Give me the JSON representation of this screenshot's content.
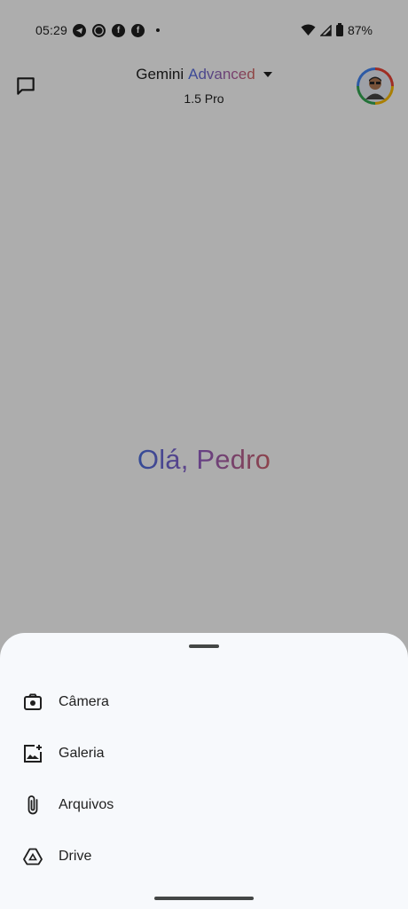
{
  "status_bar": {
    "time": "05:29",
    "notification_icons": [
      "telegram-icon",
      "whatsapp-icon",
      "facebook-icon",
      "facebook-icon"
    ],
    "battery": "87%"
  },
  "header": {
    "title_prefix": "Gemini",
    "title_tier": "Advanced",
    "model": "1.5 Pro"
  },
  "main": {
    "greeting": "Olá, Pedro"
  },
  "sheet": {
    "items": [
      {
        "label": "Câmera",
        "icon": "camera-icon"
      },
      {
        "label": "Galeria",
        "icon": "gallery-icon"
      },
      {
        "label": "Arquivos",
        "icon": "paperclip-icon"
      },
      {
        "label": "Drive",
        "icon": "drive-icon"
      }
    ]
  },
  "colors": {
    "sheet_bg": "#f7f9fc",
    "scrim": "rgba(0,0,0,0.32)",
    "gradient_start": "#4b6fe0",
    "gradient_end": "#d0646f"
  }
}
